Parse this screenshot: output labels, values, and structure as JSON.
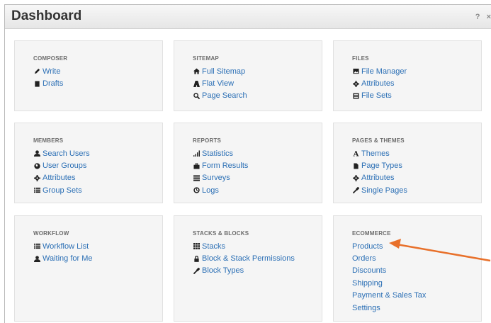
{
  "header": {
    "title": "Dashboard",
    "help_label": "?",
    "close_label": "×"
  },
  "panels": [
    {
      "title": "COMPOSER",
      "items": [
        {
          "label": "Write",
          "icon": "pencil-icon"
        },
        {
          "label": "Drafts",
          "icon": "book-icon"
        }
      ]
    },
    {
      "title": "SITEMAP",
      "items": [
        {
          "label": "Full Sitemap",
          "icon": "home-icon"
        },
        {
          "label": "Flat View",
          "icon": "road-icon"
        },
        {
          "label": "Page Search",
          "icon": "search-icon"
        }
      ]
    },
    {
      "title": "FILES",
      "items": [
        {
          "label": "File Manager",
          "icon": "picture-icon"
        },
        {
          "label": "Attributes",
          "icon": "cog-icon"
        },
        {
          "label": "File Sets",
          "icon": "list-alt-icon"
        }
      ]
    },
    {
      "title": "MEMBERS",
      "items": [
        {
          "label": "Search Users",
          "icon": "user-icon"
        },
        {
          "label": "User Groups",
          "icon": "globe-icon"
        },
        {
          "label": "Attributes",
          "icon": "cog-icon"
        },
        {
          "label": "Group Sets",
          "icon": "list-icon"
        }
      ]
    },
    {
      "title": "REPORTS",
      "items": [
        {
          "label": "Statistics",
          "icon": "signal-icon"
        },
        {
          "label": "Form Results",
          "icon": "briefcase-icon"
        },
        {
          "label": "Surveys",
          "icon": "tasks-icon"
        },
        {
          "label": "Logs",
          "icon": "clock-icon"
        }
      ]
    },
    {
      "title": "PAGES & THEMES",
      "items": [
        {
          "label": "Themes",
          "icon": "font-icon"
        },
        {
          "label": "Page Types",
          "icon": "file-icon"
        },
        {
          "label": "Attributes",
          "icon": "cog-icon"
        },
        {
          "label": "Single Pages",
          "icon": "wrench-icon"
        }
      ]
    },
    {
      "title": "WORKFLOW",
      "items": [
        {
          "label": "Workflow List",
          "icon": "list-icon"
        },
        {
          "label": "Waiting for Me",
          "icon": "user-icon"
        }
      ]
    },
    {
      "title": "STACKS & BLOCKS",
      "items": [
        {
          "label": "Stacks",
          "icon": "th-icon"
        },
        {
          "label": "Block & Stack Permissions",
          "icon": "lock-icon"
        },
        {
          "label": "Block Types",
          "icon": "wrench-icon"
        }
      ]
    },
    {
      "title": "ECOMMERCE",
      "items": [
        {
          "label": "Products",
          "icon": ""
        },
        {
          "label": "Orders",
          "icon": ""
        },
        {
          "label": "Discounts",
          "icon": ""
        },
        {
          "label": "Shipping",
          "icon": ""
        },
        {
          "label": "Payment & Sales Tax",
          "icon": ""
        },
        {
          "label": "Settings",
          "icon": ""
        }
      ]
    }
  ],
  "colors": {
    "link": "#2b6fb5",
    "annotation_arrow": "#e8702a"
  }
}
